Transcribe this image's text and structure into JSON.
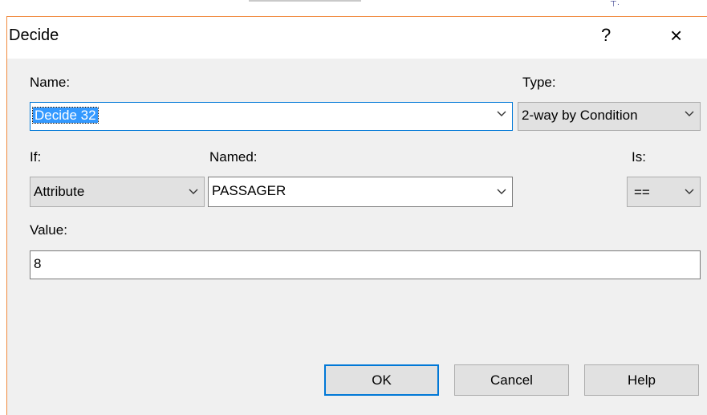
{
  "dialog": {
    "title": "Decide",
    "help_label": "?",
    "close_label": "×"
  },
  "name_label": "Name:",
  "name_value": "Decide 32",
  "type_label": "Type:",
  "type_value": "2-way by Condition",
  "if_label": "If:",
  "if_value": "Attribute",
  "named_label": "Named:",
  "named_value": "PASSAGER",
  "is_label": "Is:",
  "is_value": "==",
  "value_label": "Value:",
  "value_value": "8",
  "buttons": {
    "ok": "OK",
    "cancel": "Cancel",
    "help": "Help"
  },
  "accent_color": "#0078d7",
  "highlight_color": "#3399ff",
  "icons": [
    "question-icon",
    "close-icon",
    "chevron-down-icon"
  ]
}
